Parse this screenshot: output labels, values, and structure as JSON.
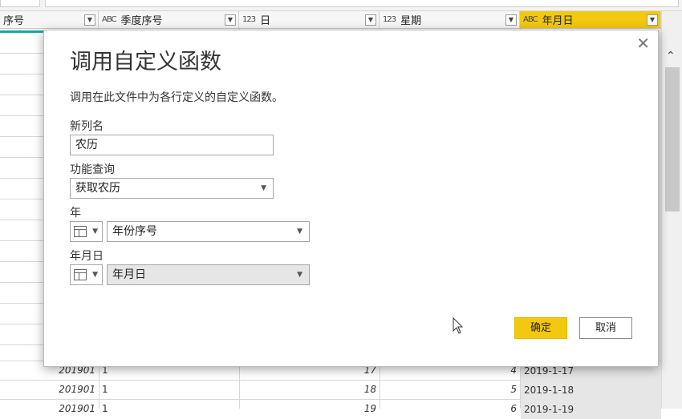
{
  "grid": {
    "columns": [
      {
        "label": "序号",
        "type_icon": ""
      },
      {
        "label": "季度序号",
        "type_icon": "ABC"
      },
      {
        "label": "日",
        "type_icon": "123"
      },
      {
        "label": "星期",
        "type_icon": "123"
      },
      {
        "label": "年月日",
        "type_icon": "ABC"
      }
    ],
    "rows": [
      {
        "c0": "201901",
        "c1": "1",
        "c2": "17",
        "c3": "4",
        "c4": "2019-1-17"
      },
      {
        "c0": "201901",
        "c1": "1",
        "c2": "18",
        "c3": "5",
        "c4": "2019-1-18"
      },
      {
        "c0": "201901",
        "c1": "1",
        "c2": "19",
        "c3": "6",
        "c4": "2019-1-19"
      }
    ],
    "active_color": "#f2c811"
  },
  "dialog": {
    "title": "调用自定义函数",
    "description": "调用在此文件中为各行定义的自定义函数。",
    "close_glyph": "✕",
    "new_column_label": "新列名",
    "new_column_value": "农历",
    "function_query_label": "功能查询",
    "function_query_value": "获取农历",
    "year_label": "年",
    "year_value": "年份序号",
    "date_label": "年月日",
    "date_value": "年月日",
    "ok_label": "确定",
    "cancel_label": "取消",
    "accent_color": "#f2c811"
  }
}
